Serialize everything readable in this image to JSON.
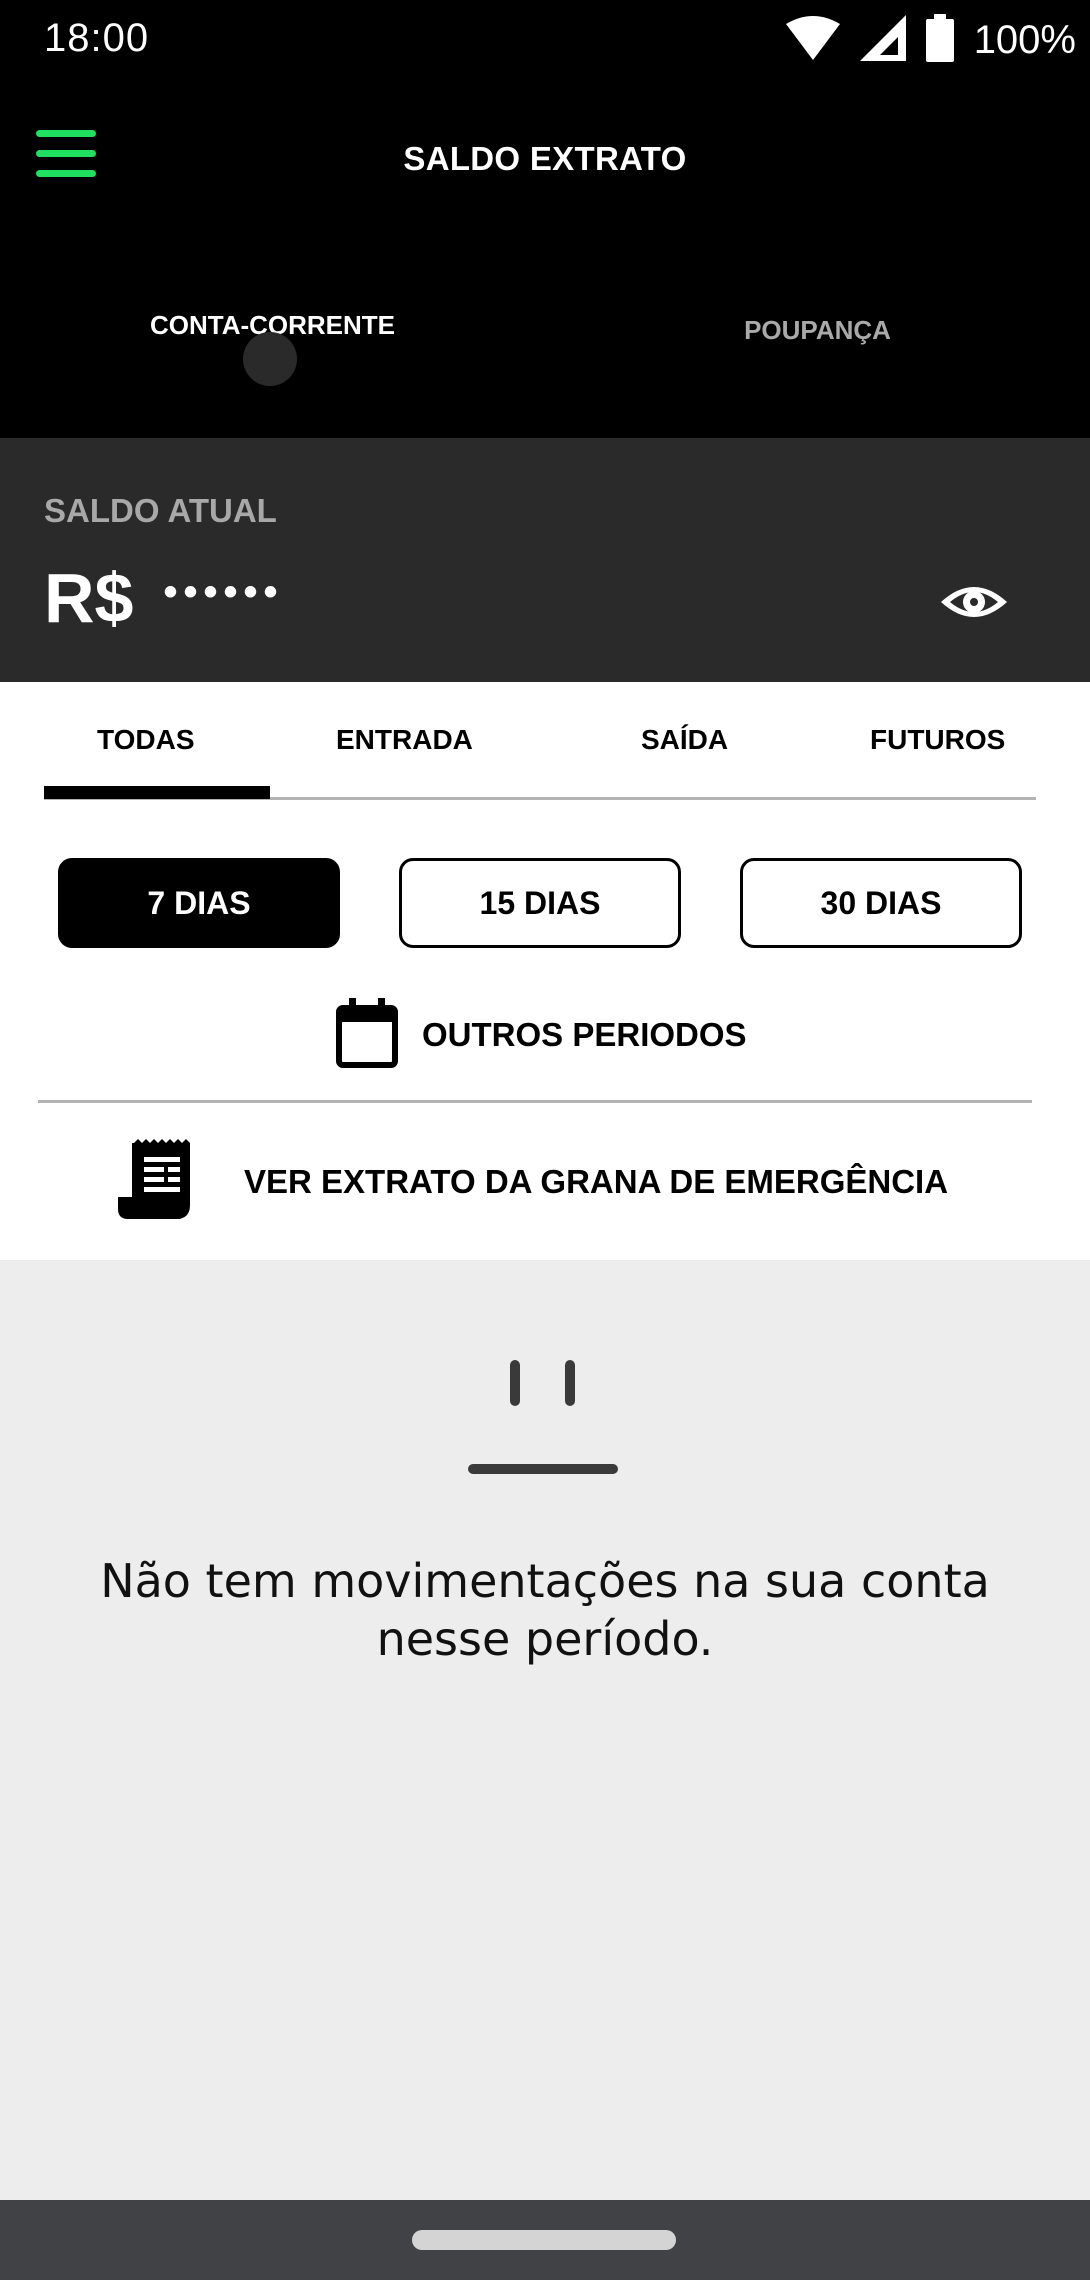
{
  "status_bar": {
    "time": "18:00",
    "battery_text": "100%",
    "icons": [
      "wifi-icon",
      "signal-icon",
      "battery-icon"
    ]
  },
  "header": {
    "title": "SALDO EXTRATO",
    "menu_icon": "hamburger-menu-icon",
    "accent_color": "#1fe05f"
  },
  "account_tabs": [
    {
      "label": "CONTA-CORRENTE",
      "active": true
    },
    {
      "label": "POUPANÇA",
      "active": false
    }
  ],
  "balance": {
    "label": "SALDO ATUAL",
    "currency": "R$",
    "masked_value": "••••••",
    "toggle_icon": "eye-icon"
  },
  "filter_tabs": [
    {
      "label": "TODAS",
      "active": true
    },
    {
      "label": "ENTRADA",
      "active": false
    },
    {
      "label": "SAÍDA",
      "active": false
    },
    {
      "label": "FUTUROS",
      "active": false
    }
  ],
  "periods": [
    {
      "label": "7 DIAS",
      "selected": true
    },
    {
      "label": "15 DIAS",
      "selected": false
    },
    {
      "label": "30 DIAS",
      "selected": false
    }
  ],
  "other_periods": {
    "label": "OUTROS PERIODOS",
    "icon": "calendar-icon"
  },
  "emergency": {
    "label": "VER EXTRATO DA GRANA DE EMERGÊNCIA",
    "icon": "receipt-icon"
  },
  "empty_state": {
    "message": "Não tem movimentações na sua conta nesse período.",
    "icon": "neutral-face-icon"
  },
  "colors": {
    "background_dark": "#000000",
    "panel_dark": "#2a2a2a",
    "empty_bg": "#ededed",
    "nav_bar": "#414245"
  }
}
